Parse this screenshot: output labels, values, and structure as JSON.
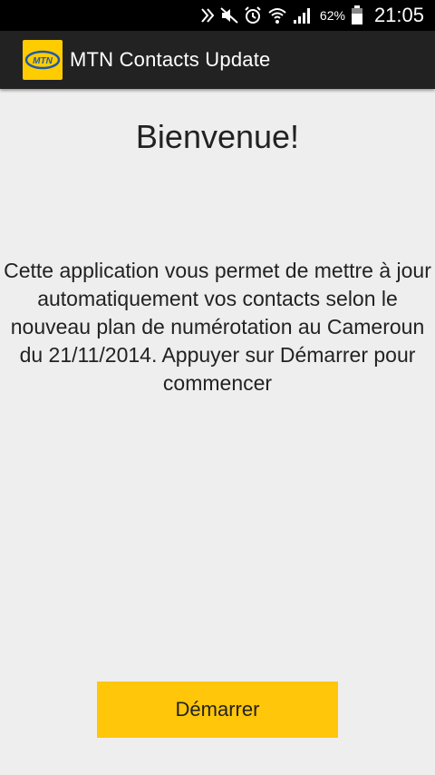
{
  "status_bar": {
    "icons": [
      "nfc-icon",
      "mute-icon",
      "alarm-icon",
      "wifi-icon",
      "signal-icon",
      "battery-icon"
    ],
    "battery_percent": "62%",
    "time": "21:05"
  },
  "action_bar": {
    "logo_text": "MTN",
    "title": "MTN Contacts Update"
  },
  "main": {
    "welcome": "Bienvenue!",
    "description": "Cette application vous permet de mettre à jour automatiquement vos contacts selon le nouveau plan de numérotation au Cameroun du 21/11/2014. Appuyer sur Démarrer pour commencer",
    "start_button": "Démarrer"
  },
  "colors": {
    "brand_yellow": "#ffcc00",
    "button_yellow": "#ffc60a",
    "action_bar": "#222222",
    "background": "#eeeeee"
  }
}
